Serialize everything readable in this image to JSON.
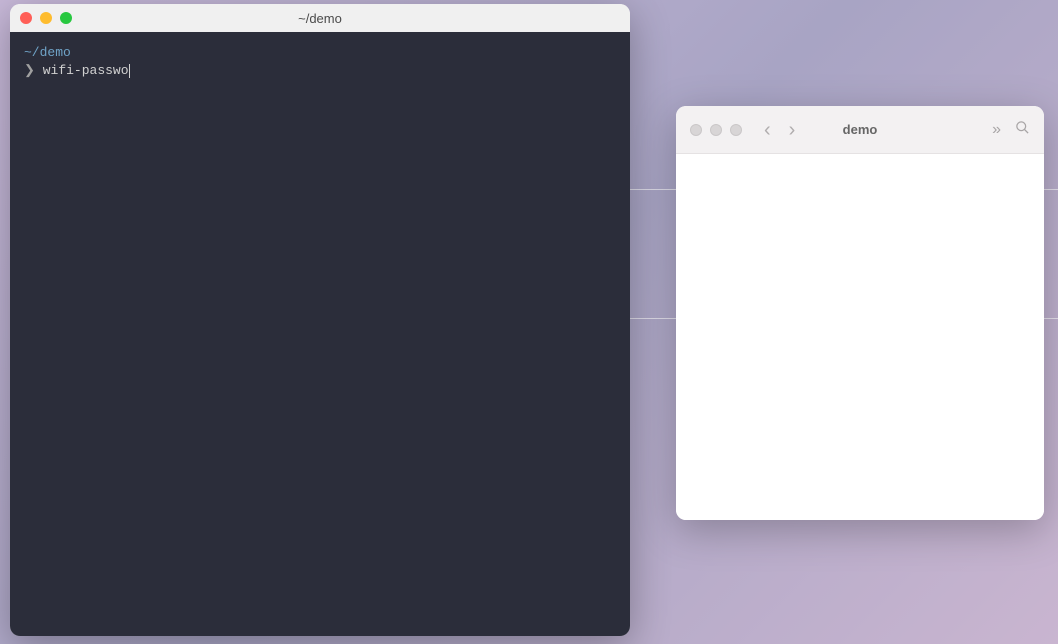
{
  "terminal": {
    "title": "~/demo",
    "path": "~/demo",
    "prompt_symbol": "❯",
    "command": "wifi-passwo"
  },
  "finder": {
    "title": "demo"
  }
}
